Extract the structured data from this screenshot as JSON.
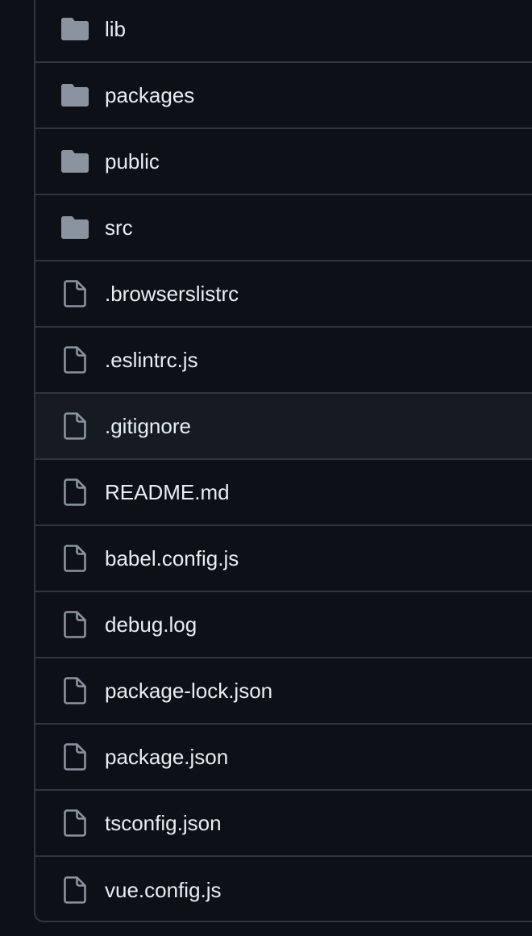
{
  "colors": {
    "background": "#0d1117",
    "border": "#30363d",
    "row_hover": "#161b22",
    "text": "#e6edf3",
    "icon": "#8b949e"
  },
  "entries": [
    {
      "name": "lib",
      "icon": "folder-icon"
    },
    {
      "name": "packages",
      "icon": "folder-icon"
    },
    {
      "name": "public",
      "icon": "folder-icon"
    },
    {
      "name": "src",
      "icon": "folder-icon"
    },
    {
      "name": ".browserslistrc",
      "icon": "file-icon"
    },
    {
      "name": ".eslintrc.js",
      "icon": "file-icon"
    },
    {
      "name": ".gitignore",
      "icon": "file-icon",
      "highlighted": true
    },
    {
      "name": "README.md",
      "icon": "file-icon"
    },
    {
      "name": "babel.config.js",
      "icon": "file-icon"
    },
    {
      "name": "debug.log",
      "icon": "file-icon"
    },
    {
      "name": "package-lock.json",
      "icon": "file-icon"
    },
    {
      "name": "package.json",
      "icon": "file-icon"
    },
    {
      "name": "tsconfig.json",
      "icon": "file-icon"
    },
    {
      "name": "vue.config.js",
      "icon": "file-icon"
    }
  ]
}
